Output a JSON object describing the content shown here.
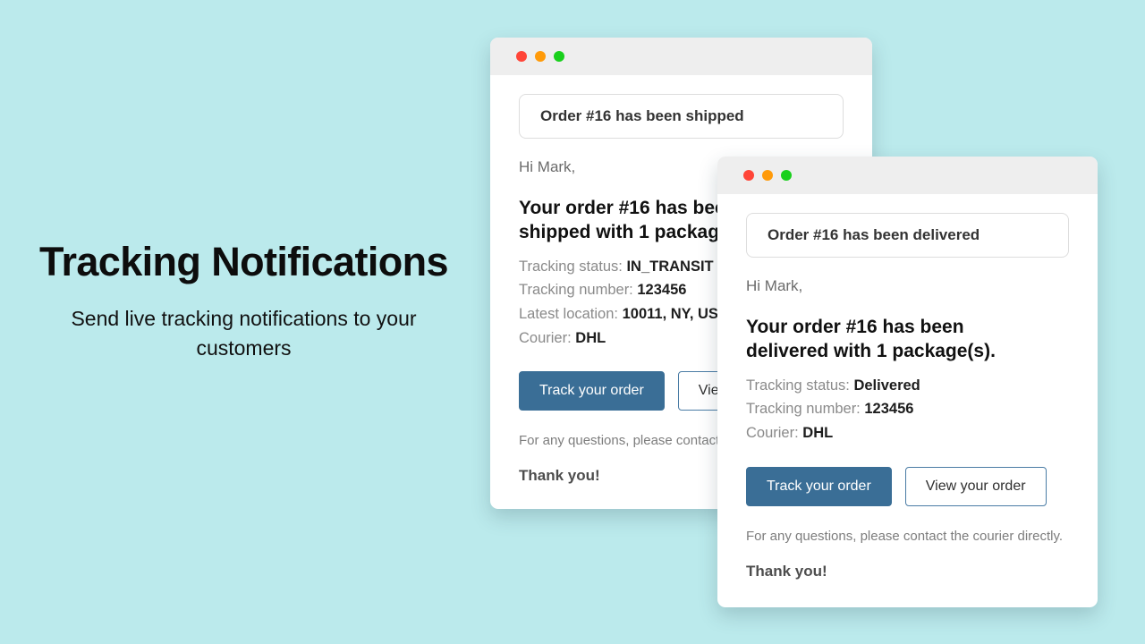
{
  "background_color": "#bbeaec",
  "promo": {
    "title": "Tracking Notifications",
    "subtitle": "Send live tracking notifications to your customers"
  },
  "colors": {
    "primary_button": "#3a6e96",
    "outline_button_border": "#4a7ca5",
    "titlebar": "#eeeeee",
    "dot_red": "#ff4538",
    "dot_yellow": "#ff9a09",
    "dot_green": "#19d01c"
  },
  "cards": {
    "back": {
      "window_dots": [
        "close-dot",
        "minimize-dot",
        "maximize-dot"
      ],
      "subject": "Order #16 has been shipped",
      "greeting": "Hi Mark,",
      "headline": "Your order #16 has been\nshipped with 1 package(s).",
      "meta": [
        {
          "label": "Tracking status:",
          "value": "IN_TRANSIT"
        },
        {
          "label": "Tracking number:",
          "value": "123456"
        },
        {
          "label": "Latest location:",
          "value": "10011, NY, USA"
        },
        {
          "label": "Courier:",
          "value": "DHL"
        }
      ],
      "buttons": {
        "primary": "Track your order",
        "outline": "View your order"
      },
      "footnote": "For any questions, please contact the courier directly.",
      "thanks": "Thank you!"
    },
    "front": {
      "window_dots": [
        "close-dot",
        "minimize-dot",
        "maximize-dot"
      ],
      "subject": "Order #16 has been delivered",
      "greeting": "Hi Mark,",
      "headline": "Your order #16 has been\ndelivered with 1 package(s).",
      "meta": [
        {
          "label": "Tracking status:",
          "value": "Delivered"
        },
        {
          "label": "Tracking number:",
          "value": "123456"
        },
        {
          "label": "Courier:",
          "value": "DHL"
        }
      ],
      "buttons": {
        "primary": "Track your order",
        "outline": "View your order"
      },
      "footnote": "For any questions, please contact the courier directly.",
      "thanks": "Thank you!"
    }
  }
}
